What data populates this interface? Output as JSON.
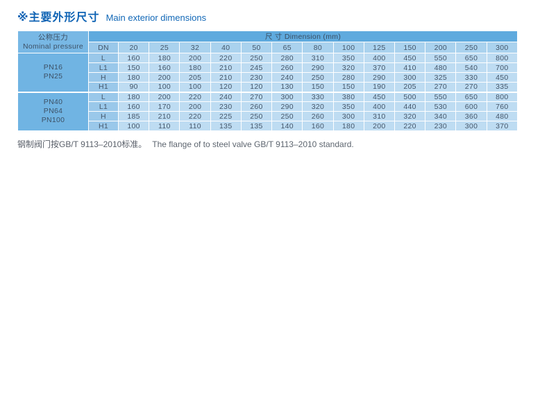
{
  "header": {
    "title_zh": "※主要外形尺寸",
    "title_en": "Main exterior dimensions"
  },
  "table": {
    "pressure_header_zh": "公称压力",
    "pressure_header_en": "Nominal pressure",
    "dimension_header": "尺 寸 Dimension (mm)",
    "dn_label": "DN",
    "dn_sizes": [
      "20",
      "25",
      "32",
      "40",
      "50",
      "65",
      "80",
      "100",
      "125",
      "150",
      "200",
      "250",
      "300"
    ],
    "blocks": [
      {
        "pressures": [
          "PN16",
          "PN25"
        ],
        "rows": [
          {
            "label": "L",
            "values": [
              "160",
              "180",
              "200",
              "220",
              "250",
              "280",
              "310",
              "350",
              "400",
              "450",
              "550",
              "650",
              "800"
            ]
          },
          {
            "label": "L1",
            "values": [
              "150",
              "160",
              "180",
              "210",
              "245",
              "260",
              "290",
              "320",
              "370",
              "410",
              "480",
              "540",
              "700"
            ]
          },
          {
            "label": "H",
            "values": [
              "180",
              "200",
              "205",
              "210",
              "230",
              "240",
              "250",
              "280",
              "290",
              "300",
              "325",
              "330",
              "450"
            ]
          },
          {
            "label": "H1",
            "values": [
              "90",
              "100",
              "100",
              "120",
              "120",
              "130",
              "150",
              "150",
              "190",
              "205",
              "270",
              "270",
              "335"
            ]
          }
        ]
      },
      {
        "pressures": [
          "PN40",
          "PN64",
          "PN100"
        ],
        "rows": [
          {
            "label": "L",
            "values": [
              "180",
              "200",
              "220",
              "240",
              "270",
              "300",
              "330",
              "380",
              "450",
              "500",
              "550",
              "650",
              "800"
            ]
          },
          {
            "label": "L1",
            "values": [
              "160",
              "170",
              "200",
              "230",
              "260",
              "290",
              "320",
              "350",
              "400",
              "440",
              "530",
              "600",
              "760"
            ]
          },
          {
            "label": "H",
            "values": [
              "185",
              "210",
              "220",
              "225",
              "250",
              "250",
              "260",
              "300",
              "310",
              "320",
              "340",
              "360",
              "480"
            ]
          },
          {
            "label": "H1",
            "values": [
              "100",
              "110",
              "110",
              "135",
              "135",
              "140",
              "160",
              "180",
              "200",
              "220",
              "230",
              "300",
              "370"
            ]
          }
        ]
      }
    ]
  },
  "footnote": {
    "zh": "钢制阀门按GB/T 9113–2010标准。",
    "en": "The flange of to steel valve GB/T 9113–2010 standard."
  },
  "colors": {
    "title_blue": "#0f63b4",
    "dimension_header_bg": "#5faade",
    "pressure_header_bg": "#78b8e5",
    "pressure_group_bg": "#70b4e3",
    "row_label_bg": "#9ac8ea",
    "dn_header_bg": "#aad2ee",
    "data_cell_bg": "#bedcf2",
    "table_text": "#44566a",
    "footnote_text": "#595f69"
  }
}
